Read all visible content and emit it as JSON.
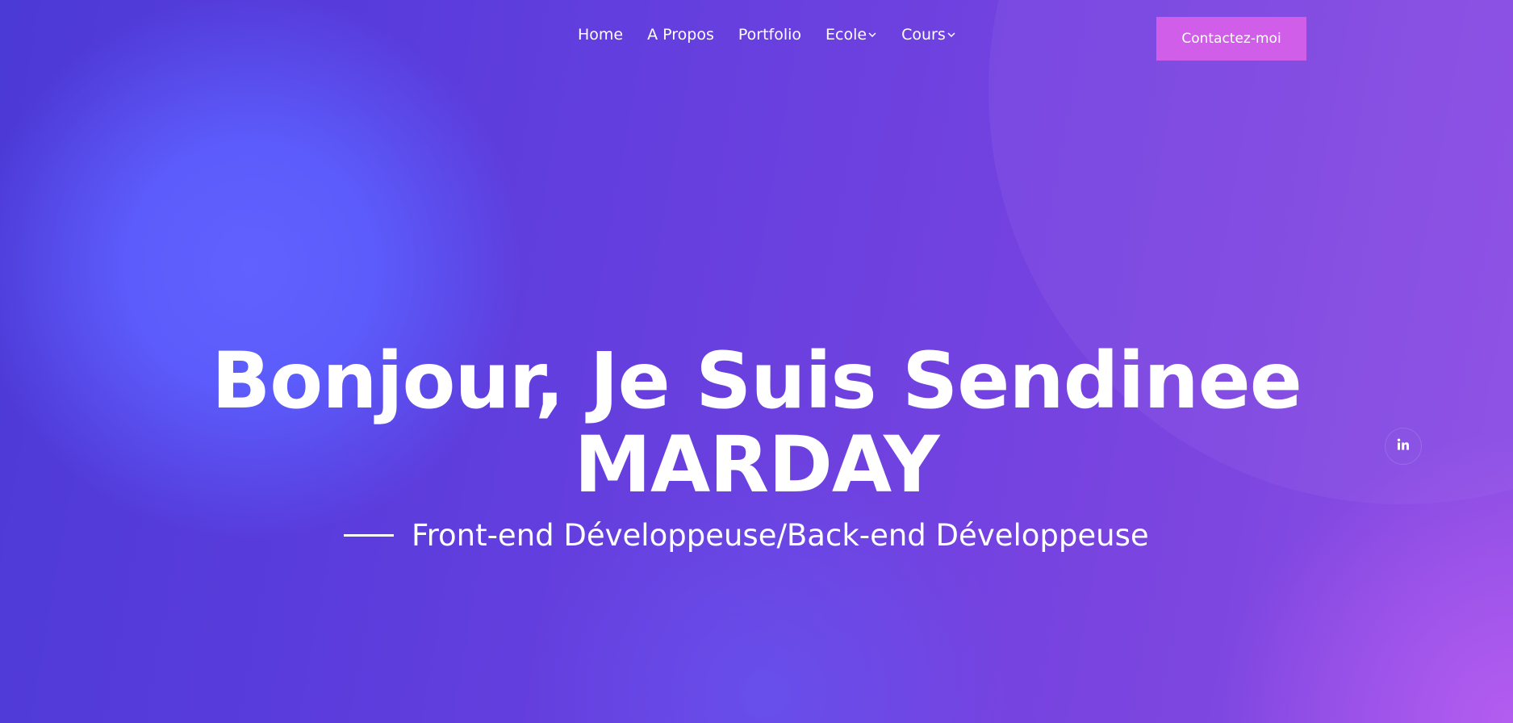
{
  "nav": {
    "items": [
      {
        "label": "Home",
        "dropdown": false
      },
      {
        "label": "A Propos",
        "dropdown": false
      },
      {
        "label": "Portfolio",
        "dropdown": false
      },
      {
        "label": "Ecole",
        "dropdown": true
      },
      {
        "label": "Cours",
        "dropdown": true
      }
    ]
  },
  "header": {
    "contact_label": "Contactez-moi"
  },
  "hero": {
    "title_line1": "Bonjour, Je Suis Sendinee",
    "title_line2": "MARDAY",
    "subtitle": "Front-end Développeuse/Back-end Développeuse"
  },
  "social": {
    "linkedin_icon": "linkedin-icon"
  },
  "colors": {
    "accent": "#d05ee8",
    "background_start": "#4c3ad6",
    "background_end": "#b45cf0"
  }
}
